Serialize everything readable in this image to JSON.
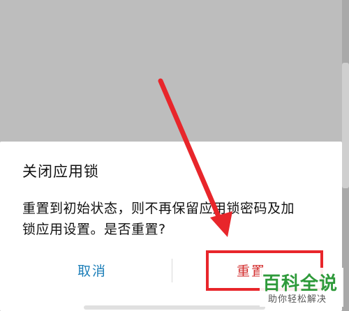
{
  "dialog": {
    "title": "关闭应用锁",
    "message_line1": "重置到初始状态，则不再保留应用锁密码及加",
    "message_line2": "锁应用设置。是否重置?",
    "cancel_label": "取消",
    "reset_label": "重置"
  },
  "watermark": {
    "title": "百科全说",
    "subtitle": "助你轻松解决"
  },
  "colors": {
    "cancel": "#1c7eb8",
    "reset": "#d32f2f",
    "annotation": "#e8262b",
    "watermark": "#2e9a3a"
  }
}
